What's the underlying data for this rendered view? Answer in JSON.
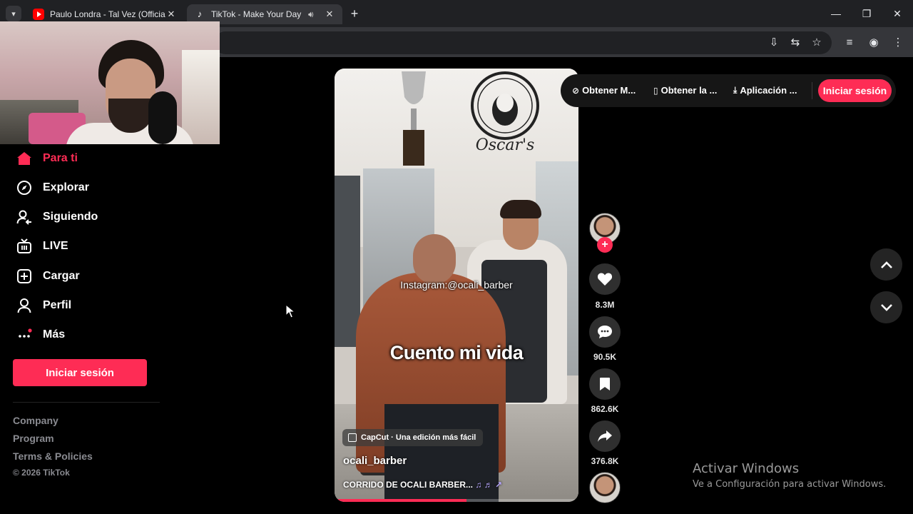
{
  "browser": {
    "tabs": [
      {
        "title": "Paulo Londra - Tal Vez (Official V",
        "favicon": "youtube-icon"
      },
      {
        "title": "TikTok - Make Your Day",
        "favicon": "tiktok-icon",
        "audio": "speaker-icon"
      }
    ],
    "new_tab_label": "+"
  },
  "sidebar": {
    "items": [
      {
        "label": "Para ti",
        "icon": "home-icon",
        "active": true
      },
      {
        "label": "Explorar",
        "icon": "compass-icon"
      },
      {
        "label": "Siguiendo",
        "icon": "user-follow-icon"
      },
      {
        "label": "LIVE",
        "icon": "live-tv-icon"
      },
      {
        "label": "Cargar",
        "icon": "upload-plus-icon"
      },
      {
        "label": "Perfil",
        "icon": "profile-icon"
      },
      {
        "label": "Más",
        "icon": "more-dots-icon"
      }
    ],
    "login_button": "Iniciar sesión",
    "footer": {
      "links": [
        "Company",
        "Program",
        "Terms & Policies"
      ],
      "copyright": "© 2026 TikTok"
    }
  },
  "topbar": {
    "links": [
      {
        "label": "Obtener M...",
        "icon": "coin-icon"
      },
      {
        "label": "Obtener la ...",
        "icon": "phone-icon"
      },
      {
        "label": "Aplicación ...",
        "icon": "download-icon"
      }
    ],
    "login_button": "Iniciar sesión"
  },
  "video": {
    "overlay_handle": "Instagram:@ocali_barber",
    "overlay_caption": "Cuento mi vida",
    "capcut_label": "CapCut · Una edición más fácil",
    "username": "ocali_barber",
    "music": "CORRIDO DE OCALI BARBER...",
    "progress": 0.54
  },
  "actions": {
    "likes": "8.3M",
    "comments": "90.5K",
    "saves": "862.6K",
    "shares": "376.8K"
  },
  "windows_watermark": {
    "title": "Activar Windows",
    "subtitle": "Ve a Configuración para activar Windows."
  },
  "colors": {
    "accent": "#fe2c55",
    "background": "#000000",
    "chrome_dark": "#202124"
  }
}
